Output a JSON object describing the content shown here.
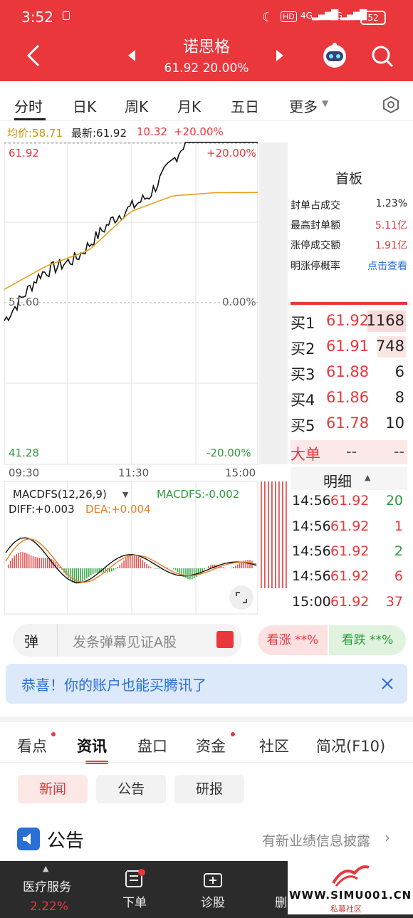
{
  "status_bar": {
    "time": "3:52",
    "hd": "HD",
    "net1": "4G",
    "net2": "5G",
    "battery": "52"
  },
  "header": {
    "stock_name": "诺思格",
    "price_line": "61.92  20.00%"
  },
  "tabs": [
    "分时",
    "日K",
    "周K",
    "月K",
    "五日",
    "更多"
  ],
  "info": {
    "avg_label": "均价:58.71",
    "latest": "最新:61.92",
    "change": "10.32",
    "change_pct": "+20.00%"
  },
  "chart_axis": {
    "top_left": "61.92",
    "top_right": "+20.00%",
    "mid_left": "51.60",
    "mid_right": "0.00%",
    "bot_left": "41.28",
    "bot_right": "-20.00%",
    "time_start": "09:30",
    "time_mid": "11:30",
    "time_end": "15:00"
  },
  "macd": {
    "title": "MACDFS(12,26,9)",
    "value": "MACDFS:-0.002",
    "diff": "DIFF:+0.003",
    "dea": "DEA:+0.004"
  },
  "panel": {
    "title": "首板",
    "rows": [
      {
        "label": "封单占成交",
        "value": "1.23%"
      },
      {
        "label": "最高封单额",
        "value": "5.11亿"
      },
      {
        "label": "涨停成交额",
        "value": "1.91亿"
      },
      {
        "label": "明涨停概率",
        "value": "点击查看"
      }
    ]
  },
  "order_book": [
    {
      "label": "买1",
      "price": "61.92",
      "qty": "1168"
    },
    {
      "label": "买2",
      "price": "61.91",
      "qty": "748"
    },
    {
      "label": "买3",
      "price": "61.88",
      "qty": "6"
    },
    {
      "label": "买4",
      "price": "61.86",
      "qty": "8"
    },
    {
      "label": "买5",
      "price": "61.78",
      "qty": "10"
    }
  ],
  "big_order": {
    "label": "大单",
    "v1": "--",
    "v2": "--"
  },
  "detail": {
    "title": "明细",
    "rows": [
      {
        "time": "14:56",
        "price": "61.92",
        "vol": "20",
        "color": "#2e9b3d"
      },
      {
        "time": "14:56",
        "price": "61.92",
        "vol": "1",
        "color": "#e9373c"
      },
      {
        "time": "14:56",
        "price": "61.92",
        "vol": "2",
        "color": "#2e9b3d"
      },
      {
        "time": "14:56",
        "price": "61.92",
        "vol": "6",
        "color": "#e9373c"
      },
      {
        "time": "15:00",
        "price": "61.92",
        "vol": "37",
        "color": "#e9373c"
      }
    ]
  },
  "danmu": {
    "icon": "弹",
    "placeholder": "发条弹幕见证A股",
    "rise": "看涨 **%",
    "fall": "看跌 **%"
  },
  "banner": {
    "text": "恭喜！你的账户也能买腾讯了"
  },
  "section_tabs": [
    "看点",
    "资讯",
    "盘口",
    "资金",
    "社区",
    "简况(F10)"
  ],
  "chips": [
    "新闻",
    "公告",
    "研报"
  ],
  "announcement": {
    "title": "公告",
    "link": "有新业绩信息披露"
  },
  "bottom_bar": {
    "sector": "医疗服务",
    "sector_pct": "2.22%",
    "order": "下单",
    "diagnose": "诊股",
    "delete": "删"
  },
  "watermark": {
    "site": "WWW.SIMU001.CN",
    "sub": "私募社区"
  },
  "chart_data": {
    "type": "line",
    "x": [
      "09:30",
      "11:30",
      "15:00"
    ],
    "series": [
      {
        "values": [
          50.5,
          53.5,
          54.5,
          57.0,
          58.5,
          61.92,
          61.92,
          61.92
        ]
      },
      {
        "values": [
          52.5,
          54.0,
          55.0,
          57.5,
          58.5,
          58.7,
          58.71
        ]
      }
    ],
    "ylim": [
      41.28,
      61.92
    ],
    "colors": {
      "price": "#111111",
      "avg": "#e6a21a"
    }
  }
}
